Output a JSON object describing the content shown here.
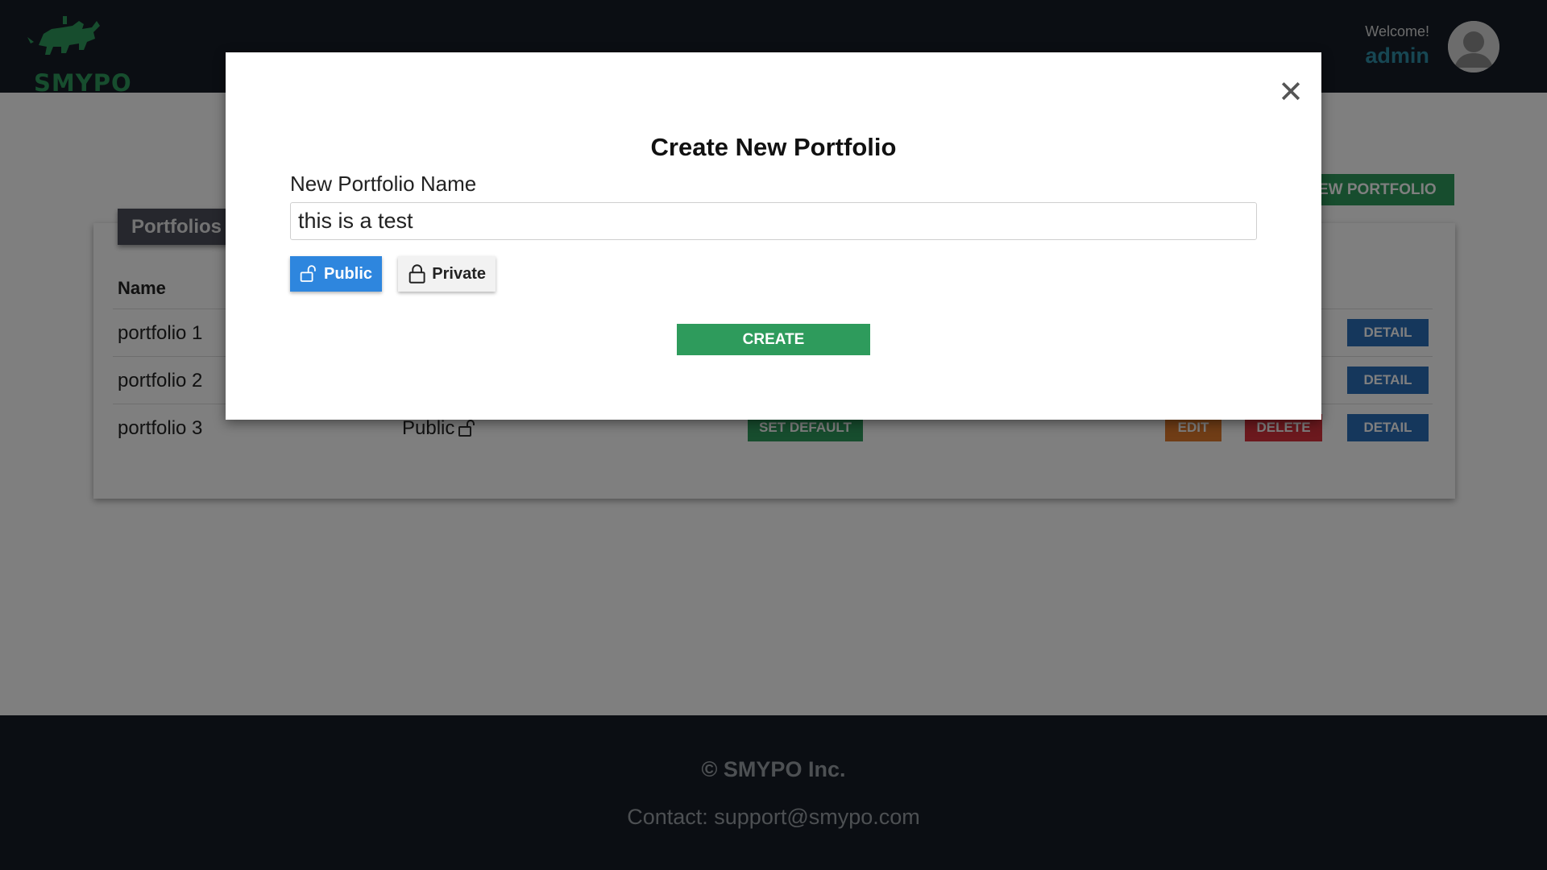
{
  "header": {
    "brand": "SMYPO",
    "welcome_label": "Welcome!",
    "username": "admin"
  },
  "main": {
    "new_portfolio_label": "NEW PORTFOLIO",
    "card_title": "Portfolios",
    "table": {
      "column_name": "Name",
      "rows": [
        {
          "name": "portfolio 1",
          "visibility": "",
          "default_label": "",
          "edit_label": "",
          "delete_label": "",
          "detail_label": "DETAIL"
        },
        {
          "name": "portfolio 2",
          "visibility": "",
          "default_label": "",
          "edit_label": "",
          "delete_label": "",
          "detail_label": "DETAIL"
        },
        {
          "name": "portfolio 3",
          "visibility": "Public",
          "default_label": "SET DEFAULT",
          "edit_label": "EDIT",
          "delete_label": "DELETE",
          "detail_label": "DETAIL"
        }
      ]
    }
  },
  "modal": {
    "close_glyph": "✕",
    "title": "Create New Portfolio",
    "field_label": "New Portfolio Name",
    "field_value": "this is a test",
    "public_label": "Public",
    "private_label": "Private",
    "selected_visibility": "Public",
    "create_label": "CREATE"
  },
  "footer": {
    "copyright": "© SMYPO Inc.",
    "contact": "Contact: support@smypo.com"
  },
  "colors": {
    "header_bg": "#161d26",
    "brand_green": "#2e9b5c",
    "username_teal": "#2e8ea6",
    "public_blue": "#2e86de",
    "edit_orange": "#e07b2c",
    "delete_red": "#d8323c",
    "detail_blue": "#2b6fb8"
  },
  "icons": {
    "logo": "bull-icon",
    "avatar": "user-avatar-icon",
    "public": "unlock-icon",
    "private": "lock-icon"
  }
}
